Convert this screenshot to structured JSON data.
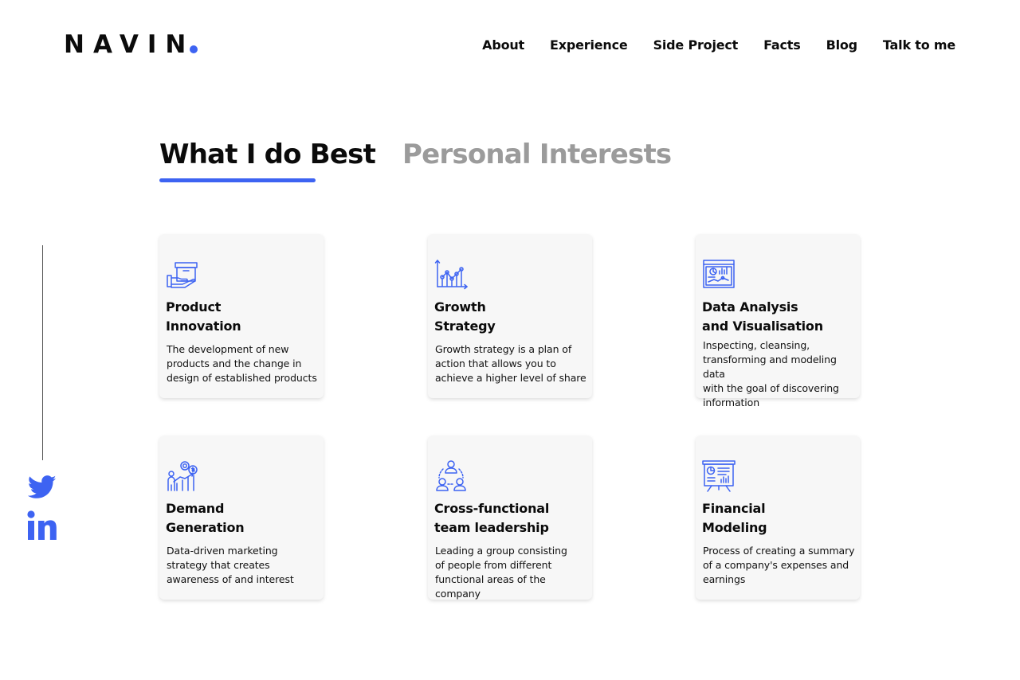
{
  "header": {
    "logo": "NAVIN",
    "nav": [
      "About",
      "Experience",
      "Side Project",
      "Facts",
      "Blog",
      "Talk to me"
    ]
  },
  "tabs": {
    "active": "What I do Best",
    "inactive": "Personal Interests"
  },
  "cards": [
    {
      "icon": "box-in-hand-icon",
      "title": "Product\nInnovation",
      "desc": "The development of new\nproducts and the change in\ndesign of established products"
    },
    {
      "icon": "growth-chart-icon",
      "title": "Growth\nStrategy",
      "desc": "Growth strategy is a plan of\naction that allows you to\nachieve a higher level of share"
    },
    {
      "icon": "data-dashboard-icon",
      "title": "Data Analysis\nand Visualisation",
      "desc": "Inspecting, cleansing,\ntransforming and modeling data\nwith the goal of discovering\ninformation"
    },
    {
      "icon": "growth-person-money-icon",
      "title": "Demand\nGeneration",
      "desc": "Data-driven marketing\nstrategy that creates\nawareness of and interest"
    },
    {
      "icon": "team-network-icon",
      "title": "Cross-functional\nteam leadership",
      "desc": "Leading a  group consisting\nof people from different\nfunctional areas of the company"
    },
    {
      "icon": "presentation-board-icon",
      "title": "Financial\nModeling",
      "desc": "Process of creating a summary\nof a company's expenses and\nearnings"
    }
  ],
  "social": [
    "twitter-icon",
    "linkedin-icon"
  ],
  "colors": {
    "accent": "#3d63f2",
    "text": "#0b0b0b",
    "inactive_tab": "#9b9b9b",
    "card_bg": "#f7f7f7"
  }
}
